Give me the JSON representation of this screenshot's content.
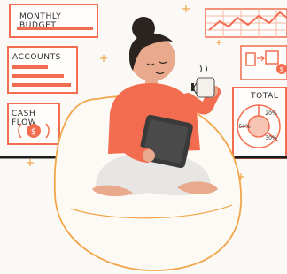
{
  "cards": {
    "monthly_budget": {
      "title": "MONTHLY BUDGET"
    },
    "accounts": {
      "title": "ACCOUNTS"
    },
    "cash_flow": {
      "title": "CASH FLOW",
      "currency_symbol": "$"
    },
    "total": {
      "title": "TOTAL",
      "segments": [
        "20%",
        "50%",
        "30%"
      ]
    },
    "transfer": {
      "currency_symbol": "$"
    }
  },
  "colors": {
    "accent": "#f26d4f",
    "ink": "#2b2b2b",
    "skin": "#e9a98c",
    "beanbag_outline": "#f2a64a",
    "tablet": "#3a3a3a"
  }
}
